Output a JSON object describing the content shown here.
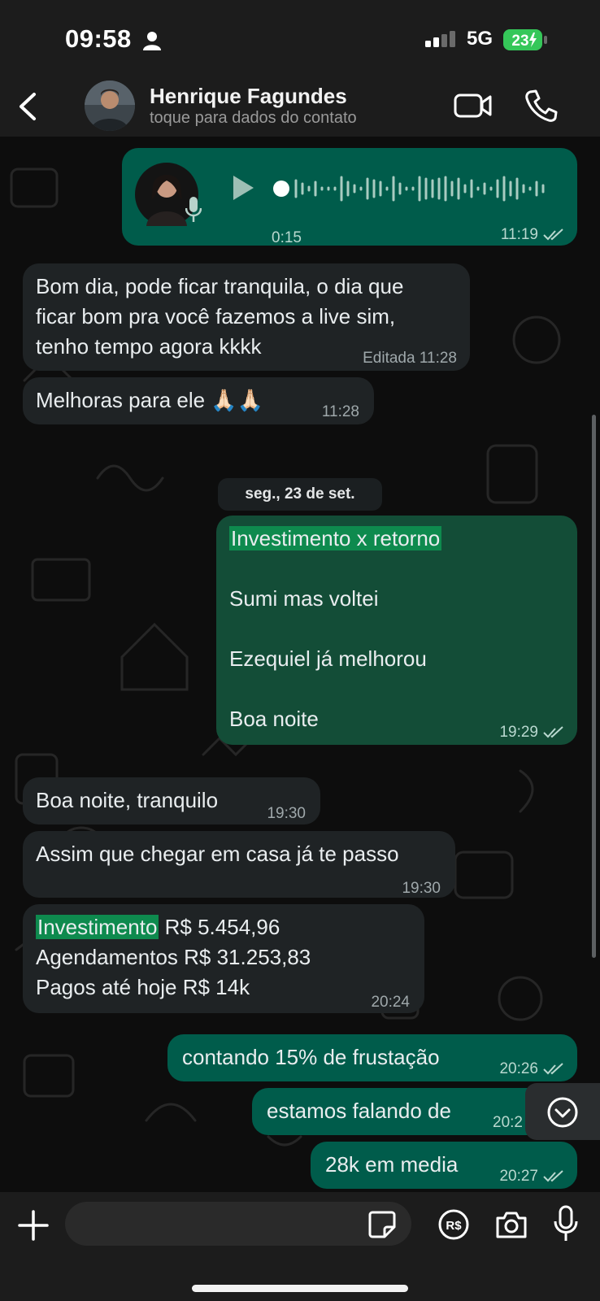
{
  "status_bar": {
    "time": "09:58",
    "network": "5G",
    "battery": "23"
  },
  "header": {
    "contact_name": "Henrique Fagundes",
    "contact_subtitle": "toque para dados do contato"
  },
  "messages": [
    {
      "direction": "out",
      "type": "audio",
      "duration": "0:15",
      "time": "11:19",
      "read": true
    },
    {
      "direction": "in",
      "lines": [
        "Bom dia, pode ficar tranquila, o dia que",
        "ficar bom pra você fazemos a live sim,",
        "tenho tempo agora kkkk"
      ],
      "edited_label": "Editada",
      "time": "11:28"
    },
    {
      "direction": "in",
      "text": "Melhoras para ele 🙏🏻🙏🏻",
      "time": "11:28"
    },
    {
      "direction": "out",
      "lines": [
        "Investimento x retorno",
        "Sumi mas voltei",
        "Ezequiel já melhorou",
        "Boa noite"
      ],
      "time": "19:29",
      "read": true
    },
    {
      "direction": "in",
      "text": "Boa noite, tranquilo",
      "time": "19:30"
    },
    {
      "direction": "in",
      "text": "Assim que chegar em casa já te passo",
      "time": "19:30"
    },
    {
      "direction": "in",
      "highlight": "Investimento",
      "line1_rest": " R$ 5.454,96",
      "lines": [
        "Agendamentos R$ 31.253,83",
        "Pagos até hoje R$ 14k"
      ],
      "time": "20:24"
    },
    {
      "direction": "out",
      "text": "contando 15% de frustação",
      "time": "20:26",
      "read": true
    },
    {
      "direction": "out",
      "text": "estamos falando de",
      "time": "20:2"
    },
    {
      "direction": "out",
      "text": "28k em media",
      "time": "20:27",
      "read": true
    }
  ],
  "date_separator": "seg., 23 de set.",
  "input": {
    "value": ""
  },
  "colors": {
    "outgoing_bubble": "#005c4b",
    "incoming_bubble": "#1f2325",
    "highlight": "#0e8a4e",
    "read_ticks": "#b9d8cf",
    "battery": "#35c759"
  },
  "icons": [
    "back-icon",
    "video-icon",
    "phone-icon",
    "play-icon",
    "mic-icon",
    "plus-icon",
    "sticker-icon",
    "pix-icon",
    "camera-icon",
    "chevron-down-icon"
  ]
}
